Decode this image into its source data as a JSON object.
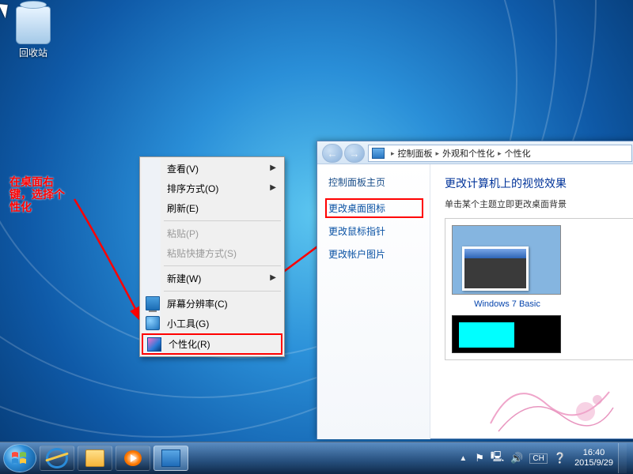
{
  "desktop": {
    "recycle_bin": "回收站"
  },
  "annotation": "在桌面右键，选择个性化",
  "context_menu": {
    "view": "查看(V)",
    "sort": "排序方式(O)",
    "refresh": "刷新(E)",
    "paste": "粘贴(P)",
    "paste_shortcut": "粘贴快捷方式(S)",
    "new": "新建(W)",
    "resolution": "屏幕分辨率(C)",
    "gadgets": "小工具(G)",
    "personalize": "个性化(R)"
  },
  "window": {
    "breadcrumb": {
      "root": "控制面板",
      "mid": "外观和个性化",
      "leaf": "个性化"
    },
    "side": {
      "header": "控制面板主页",
      "change_icons": "更改桌面图标",
      "change_pointer": "更改鼠标指针",
      "change_picture": "更改帐户图片"
    },
    "main": {
      "title": "更改计算机上的视觉效果",
      "subtitle": "单击某个主题立即更改桌面背景",
      "theme1": "Windows 7 Basic"
    }
  },
  "taskbar": {
    "time": "16:40",
    "date": "2015/9/29",
    "lang": "CH"
  }
}
